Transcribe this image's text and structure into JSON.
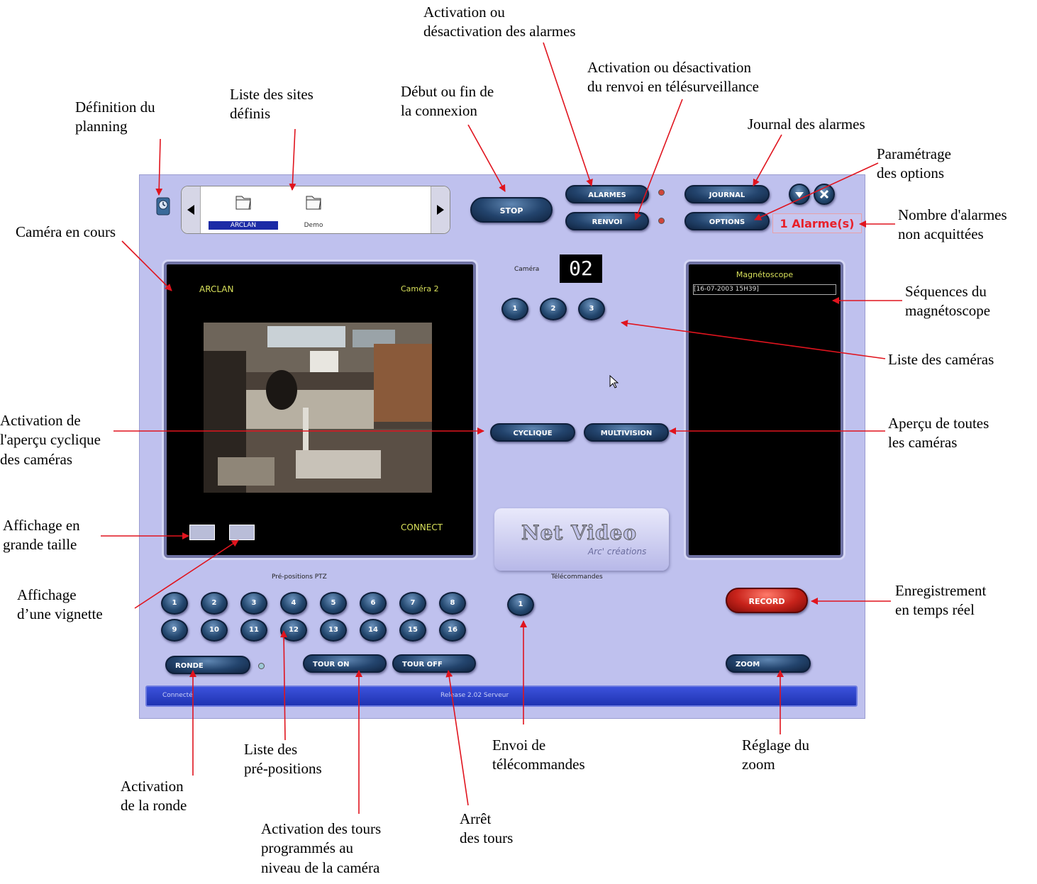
{
  "app": {
    "stop_label": "STOP",
    "alarmes_label": "ALARMES",
    "renvoi_label": "RENVOI",
    "journal_label": "JOURNAL",
    "options_label": "OPTIONS",
    "alarm_count_text": "1 Alarme(s)",
    "sites": [
      {
        "label": "ARCLAN"
      },
      {
        "label": "Demo"
      }
    ],
    "video": {
      "site": "ARCLAN",
      "camera": "Caméra 2",
      "status": "CONNECT"
    },
    "camera_label": "Caméra",
    "camera_number": "02",
    "cameras": [
      "1",
      "2",
      "3"
    ],
    "cyclique_label": "CYCLIQUE",
    "multivision_label": "MULTIVISION",
    "logo_title": "Net Video",
    "logo_subtitle": "Arc' créations",
    "vcr": {
      "title": "Magnétoscope",
      "items": [
        "[16-07-2003 15H39]"
      ]
    },
    "ptz_label": "Pré-positions PTZ",
    "ptz_presets": [
      "1",
      "2",
      "3",
      "4",
      "5",
      "6",
      "7",
      "8",
      "9",
      "10",
      "11",
      "12",
      "13",
      "14",
      "15",
      "16"
    ],
    "telecommandes_label": "Télécommandes",
    "telecommandes": [
      "1"
    ],
    "record_label": "RECORD",
    "ronde_label": "RONDE",
    "tour_on_label": "TOUR ON",
    "tour_off_label": "TOUR OFF",
    "zoom_label": "ZOOM",
    "status_left": "Connecté",
    "status_center": "Release 2.02 Serveur",
    "colors": {
      "background": "#bfc1ee",
      "button": "#23446d",
      "record": "#c8231b",
      "alarm_text": "#e8202a",
      "status_bar": "#2a3fc9"
    }
  },
  "annotations": {
    "planning": "Définition  du\nplanning",
    "sites": "Liste des sites\ndéfinis",
    "connexion": "Début ou fin de\nla connexion",
    "alarmes": "Activation ou\ndésactivation des alarmes",
    "renvoi": "Activation ou désactivation\ndu renvoi en télésurveillance",
    "journal": "Journal des alarmes",
    "options": "Paramétrage\ndes options",
    "nb_alarmes": "Nombre d'alarmes\nnon acquittées",
    "camera_cours": "Caméra en cours",
    "sequences": "Séquences du\nmagnétoscope",
    "liste_cameras": "Liste des caméras",
    "cyclique": "Activation de\nl'aperçu cyclique\ndes caméras",
    "apercu": "Aperçu de toutes\nles caméras",
    "grande_taille": "Affichage en\ngrande taille",
    "vignette": "Affichage\nd’une vignette",
    "enregistrement": "Enregistrement\nen temps réel",
    "ronde": "Activation\nde la ronde",
    "prepositions": "Liste des\npré-positions",
    "tours_on": "Activation des tours\nprogrammés au\nniveau de la caméra",
    "tours_off": "Arrêt\ndes tours",
    "telecommandes": "Envoi de\ntélécommandes",
    "zoom": "Réglage du\nzoom"
  }
}
